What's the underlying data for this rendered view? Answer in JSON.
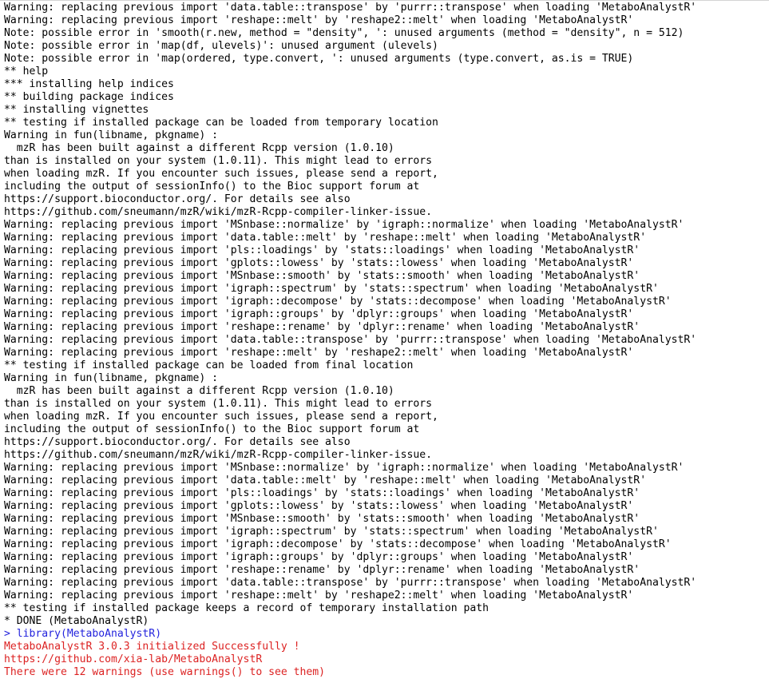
{
  "window": {
    "kind": "r-console-output",
    "background_color": "#ffffff",
    "default_text_color": "#000000",
    "command_text_color": "#2323dd",
    "message_text_color": "#dc2222",
    "top_border_color": "#d4d4d4"
  },
  "console": {
    "lines": [
      {
        "text": "Warning: replacing previous import 'data.table::transpose' by 'purrr::transpose' when loading 'MetaboAnalystR'",
        "color": "black"
      },
      {
        "text": "Warning: replacing previous import 'reshape::melt' by 'reshape2::melt' when loading 'MetaboAnalystR'",
        "color": "black"
      },
      {
        "text": "Note: possible error in 'smooth(r.new, method = \"density\", ': unused arguments (method = \"density\", n = 512)",
        "color": "black"
      },
      {
        "text": "Note: possible error in 'map(df, ulevels)': unused argument (ulevels)",
        "color": "black"
      },
      {
        "text": "Note: possible error in 'map(ordered, type.convert, ': unused arguments (type.convert, as.is = TRUE)",
        "color": "black"
      },
      {
        "text": "** help",
        "color": "black"
      },
      {
        "text": "*** installing help indices",
        "color": "black"
      },
      {
        "text": "** building package indices",
        "color": "black"
      },
      {
        "text": "** installing vignettes",
        "color": "black"
      },
      {
        "text": "** testing if installed package can be loaded from temporary location",
        "color": "black"
      },
      {
        "text": "Warning in fun(libname, pkgname) :",
        "color": "black"
      },
      {
        "text": "  mzR has been built against a different Rcpp version (1.0.10)",
        "color": "black"
      },
      {
        "text": "than is installed on your system (1.0.11). This might lead to errors",
        "color": "black"
      },
      {
        "text": "when loading mzR. If you encounter such issues, please send a report,",
        "color": "black"
      },
      {
        "text": "including the output of sessionInfo() to the Bioc support forum at",
        "color": "black"
      },
      {
        "text": "https://support.bioconductor.org/. For details see also",
        "color": "black"
      },
      {
        "text": "https://github.com/sneumann/mzR/wiki/mzR-Rcpp-compiler-linker-issue.",
        "color": "black"
      },
      {
        "text": "Warning: replacing previous import 'MSnbase::normalize' by 'igraph::normalize' when loading 'MetaboAnalystR'",
        "color": "black"
      },
      {
        "text": "Warning: replacing previous import 'data.table::melt' by 'reshape::melt' when loading 'MetaboAnalystR'",
        "color": "black"
      },
      {
        "text": "Warning: replacing previous import 'pls::loadings' by 'stats::loadings' when loading 'MetaboAnalystR'",
        "color": "black"
      },
      {
        "text": "Warning: replacing previous import 'gplots::lowess' by 'stats::lowess' when loading 'MetaboAnalystR'",
        "color": "black"
      },
      {
        "text": "Warning: replacing previous import 'MSnbase::smooth' by 'stats::smooth' when loading 'MetaboAnalystR'",
        "color": "black"
      },
      {
        "text": "Warning: replacing previous import 'igraph::spectrum' by 'stats::spectrum' when loading 'MetaboAnalystR'",
        "color": "black"
      },
      {
        "text": "Warning: replacing previous import 'igraph::decompose' by 'stats::decompose' when loading 'MetaboAnalystR'",
        "color": "black"
      },
      {
        "text": "Warning: replacing previous import 'igraph::groups' by 'dplyr::groups' when loading 'MetaboAnalystR'",
        "color": "black"
      },
      {
        "text": "Warning: replacing previous import 'reshape::rename' by 'dplyr::rename' when loading 'MetaboAnalystR'",
        "color": "black"
      },
      {
        "text": "Warning: replacing previous import 'data.table::transpose' by 'purrr::transpose' when loading 'MetaboAnalystR'",
        "color": "black"
      },
      {
        "text": "Warning: replacing previous import 'reshape::melt' by 'reshape2::melt' when loading 'MetaboAnalystR'",
        "color": "black"
      },
      {
        "text": "** testing if installed package can be loaded from final location",
        "color": "black"
      },
      {
        "text": "Warning in fun(libname, pkgname) :",
        "color": "black"
      },
      {
        "text": "  mzR has been built against a different Rcpp version (1.0.10)",
        "color": "black"
      },
      {
        "text": "than is installed on your system (1.0.11). This might lead to errors",
        "color": "black"
      },
      {
        "text": "when loading mzR. If you encounter such issues, please send a report,",
        "color": "black"
      },
      {
        "text": "including the output of sessionInfo() to the Bioc support forum at",
        "color": "black"
      },
      {
        "text": "https://support.bioconductor.org/. For details see also",
        "color": "black"
      },
      {
        "text": "https://github.com/sneumann/mzR/wiki/mzR-Rcpp-compiler-linker-issue.",
        "color": "black"
      },
      {
        "text": "Warning: replacing previous import 'MSnbase::normalize' by 'igraph::normalize' when loading 'MetaboAnalystR'",
        "color": "black"
      },
      {
        "text": "Warning: replacing previous import 'data.table::melt' by 'reshape::melt' when loading 'MetaboAnalystR'",
        "color": "black"
      },
      {
        "text": "Warning: replacing previous import 'pls::loadings' by 'stats::loadings' when loading 'MetaboAnalystR'",
        "color": "black"
      },
      {
        "text": "Warning: replacing previous import 'gplots::lowess' by 'stats::lowess' when loading 'MetaboAnalystR'",
        "color": "black"
      },
      {
        "text": "Warning: replacing previous import 'MSnbase::smooth' by 'stats::smooth' when loading 'MetaboAnalystR'",
        "color": "black"
      },
      {
        "text": "Warning: replacing previous import 'igraph::spectrum' by 'stats::spectrum' when loading 'MetaboAnalystR'",
        "color": "black"
      },
      {
        "text": "Warning: replacing previous import 'igraph::decompose' by 'stats::decompose' when loading 'MetaboAnalystR'",
        "color": "black"
      },
      {
        "text": "Warning: replacing previous import 'igraph::groups' by 'dplyr::groups' when loading 'MetaboAnalystR'",
        "color": "black"
      },
      {
        "text": "Warning: replacing previous import 'reshape::rename' by 'dplyr::rename' when loading 'MetaboAnalystR'",
        "color": "black"
      },
      {
        "text": "Warning: replacing previous import 'data.table::transpose' by 'purrr::transpose' when loading 'MetaboAnalystR'",
        "color": "black"
      },
      {
        "text": "Warning: replacing previous import 'reshape::melt' by 'reshape2::melt' when loading 'MetaboAnalystR'",
        "color": "black"
      },
      {
        "text": "** testing if installed package keeps a record of temporary installation path",
        "color": "black"
      },
      {
        "text": "* DONE (MetaboAnalystR)",
        "color": "black"
      },
      {
        "text": "> library(MetaboAnalystR)",
        "color": "blue"
      },
      {
        "text": "MetaboAnalystR 3.0.3 initialized Successfully !",
        "color": "red"
      },
      {
        "text": "https://github.com/xia-lab/MetaboAnalystR",
        "color": "red"
      },
      {
        "text": "There were 12 warnings (use warnings() to see them)",
        "color": "red"
      }
    ]
  }
}
